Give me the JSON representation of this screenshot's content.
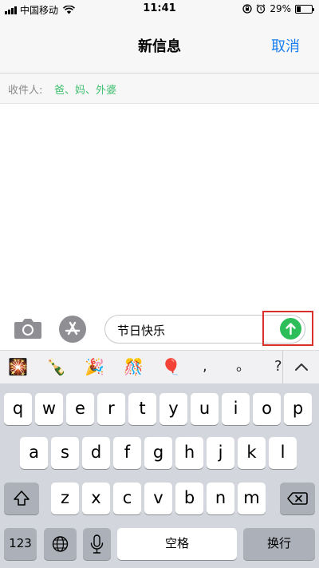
{
  "status_bar": {
    "carrier": "中国移动",
    "time": "11:41",
    "battery_percent": "29%",
    "battery_level": 0.29
  },
  "nav": {
    "title": "新信息",
    "cancel_label": "取消"
  },
  "recipients": {
    "label": "收件人:",
    "names": "爸、妈、外婆"
  },
  "compose": {
    "text_value": "节日快乐"
  },
  "suggestions": {
    "items": [
      {
        "text": "🎇",
        "icon": "fireworks-icon"
      },
      {
        "text": "🍾",
        "icon": "champagne-icon"
      },
      {
        "text": "🎉",
        "icon": "party-popper-icon"
      },
      {
        "text": "🎊",
        "icon": "confetti-ball-icon"
      },
      {
        "text": "🎈",
        "icon": "balloon-icon"
      },
      {
        "text": ",",
        "icon": ""
      },
      {
        "text": "。",
        "icon": ""
      },
      {
        "text": "?",
        "icon": ""
      }
    ]
  },
  "keyboard": {
    "row1": [
      "q",
      "w",
      "e",
      "r",
      "t",
      "y",
      "u",
      "i",
      "o",
      "p"
    ],
    "row2": [
      "a",
      "s",
      "d",
      "f",
      "g",
      "h",
      "j",
      "k",
      "l"
    ],
    "row3": [
      "z",
      "x",
      "c",
      "v",
      "b",
      "n",
      "m"
    ],
    "numbers_label": "123",
    "space_label": "空格",
    "return_label": "换行"
  },
  "colors": {
    "accent_blue": "#1a7ff0",
    "recipient_green": "#3fbf6f",
    "send_green": "#2dbe5a",
    "highlight_red": "#d9302b"
  }
}
